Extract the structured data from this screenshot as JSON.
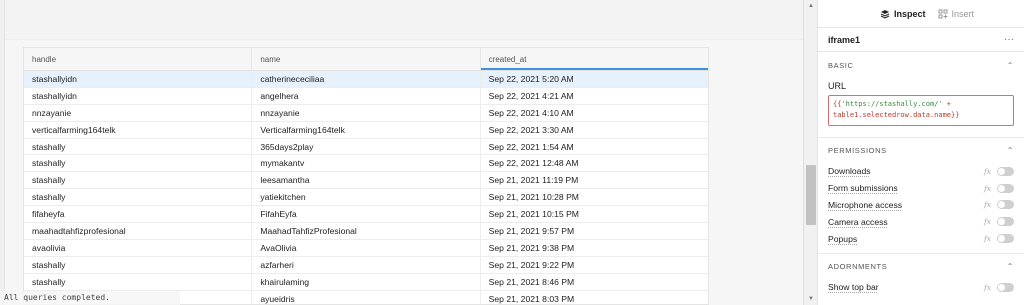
{
  "table": {
    "columns": [
      "handle",
      "name",
      "created_at"
    ],
    "rows": [
      [
        "stashallyidn",
        "catherinececiliaa",
        "Sep 22, 2021 5:20 AM"
      ],
      [
        "stashallyidn",
        "angelhera",
        "Sep 22, 2021 4:21 AM"
      ],
      [
        "nnzayanie",
        "nnzayanie",
        "Sep 22, 2021 4:10 AM"
      ],
      [
        "verticalfarming164telk",
        "Verticalfarming164telk",
        "Sep 22, 2021 3:30 AM"
      ],
      [
        "stashally",
        "365days2play",
        "Sep 22, 2021 1:54 AM"
      ],
      [
        "stashally",
        "mymakantv",
        "Sep 22, 2021 12:48 AM"
      ],
      [
        "stashally",
        "leesamantha",
        "Sep 21, 2021 11:19 PM"
      ],
      [
        "stashally",
        "yatiekitchen",
        "Sep 21, 2021 10:28 PM"
      ],
      [
        "fifaheyfa",
        "FifahEyfa",
        "Sep 21, 2021 10:15 PM"
      ],
      [
        "maahadtahfizprofesional",
        "MaahadTahfizProfesional",
        "Sep 21, 2021 9:57 PM"
      ],
      [
        "avaolivia",
        "AvaOlivia",
        "Sep 21, 2021 9:38 PM"
      ],
      [
        "stashally",
        "azfarheri",
        "Sep 21, 2021 9:22 PM"
      ],
      [
        "stashally",
        "khairulaming",
        "Sep 21, 2021 8:46 PM"
      ],
      [
        "",
        "ayueidris",
        "Sep 21, 2021 8:03 PM"
      ]
    ]
  },
  "status_text": "All queries completed.",
  "inspector": {
    "tabs": [
      {
        "label": "Inspect",
        "icon": "layers-icon",
        "active": true
      },
      {
        "label": "Insert",
        "icon": "grid-plus-icon",
        "active": false
      }
    ],
    "component_name": "iframe1",
    "more_label": "···",
    "sections": {
      "basic": {
        "title": "BASIC",
        "url_label": "URL",
        "url_code_open": "{{",
        "url_code_string": "'https://stashally.com/'",
        "url_code_op": " +",
        "url_code_line2": "table1.selectedrow.data.name",
        "url_code_close": "}}"
      },
      "permissions": {
        "title": "PERMISSIONS",
        "items": [
          "Downloads",
          "Form submissions",
          "Microphone access",
          "Camera access",
          "Popups"
        ]
      },
      "adornments": {
        "title": "ADORNMENTS",
        "items": [
          "Show top bar"
        ]
      }
    },
    "fx_label": "fx"
  },
  "colors": {
    "accent": "#3c92dc",
    "selected_row": "#e6f1fb",
    "error_border": "#e06b6b"
  }
}
